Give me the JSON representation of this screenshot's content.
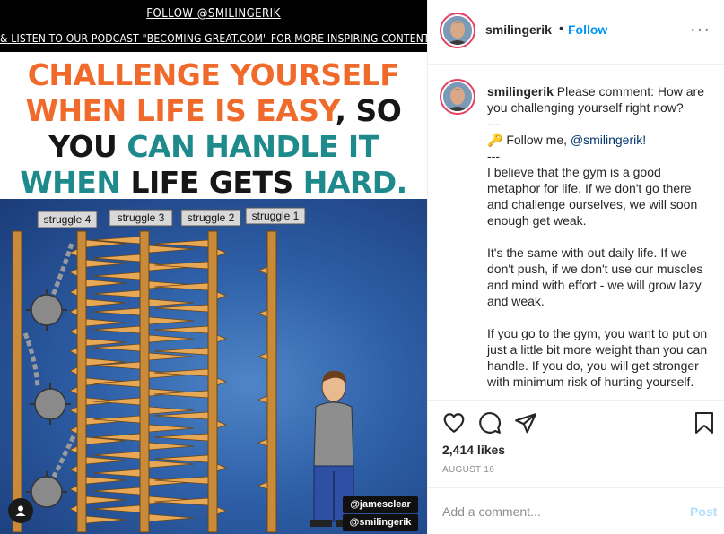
{
  "post_image": {
    "banner_line1": "FOLLOW @SMILINGERIK",
    "banner_line2": "& LISTEN TO OUR PODCAST \"BECOMING GREAT.COM\" FOR MORE INSPIRING CONTENT",
    "headline": {
      "r1_a": "CHALLENGE YOURSELF",
      "r2_a": "WHEN LIFE IS EASY",
      "r2_b": ", SO",
      "r3_a": "YOU ",
      "r3_b": "CAN HANDLE IT",
      "r4_a": "WHEN ",
      "r4_b": "LIFE GETS ",
      "r4_c": "HARD."
    },
    "struggle_labels": [
      "struggle 4",
      "struggle 3",
      "struggle 2",
      "struggle 1"
    ],
    "watermarks": [
      "@jamesclear",
      "@smilingerik"
    ],
    "user_tag_icon": "person-icon"
  },
  "header": {
    "username": "smilingerik",
    "separator": "•",
    "follow_label": "Follow",
    "more_icon": "more-options-icon",
    "more_glyph": "···"
  },
  "caption": {
    "username": "smilingerik",
    "line1": " Please comment: How are you challenging yourself right now?",
    "sep1": "---",
    "follow_emoji": "🔑",
    "follow_text": " Follow me, ",
    "follow_mention": "@smilingerik!",
    "sep2": "---",
    "para1": "I believe that the gym is a good metaphor for life. If we don't go there and challenge ourselves, we will soon enough get weak.",
    "para2": "It's the same with out daily life. If we don't push, if we don't use our muscles and mind with effort - we will grow lazy and weak.",
    "para3": "If you go to the gym, you want to put on just a little bit more weight than you can handle. If you do, you will get stronger with minimum risk of hurting yourself."
  },
  "actions": {
    "like_icon": "heart-icon",
    "comment_icon": "comment-icon",
    "share_icon": "share-icon",
    "save_icon": "bookmark-icon",
    "likes": "2,414 likes",
    "date": "AUGUST 16"
  },
  "comment_box": {
    "placeholder": "Add a comment...",
    "post_label": "Post"
  },
  "colors": {
    "follow_blue": "#0095f6",
    "post_disabled": "#b2dffc",
    "headline_orange": "#f06b2b",
    "headline_teal": "#1e8a8c",
    "avatar_ring": "#e4405f"
  }
}
